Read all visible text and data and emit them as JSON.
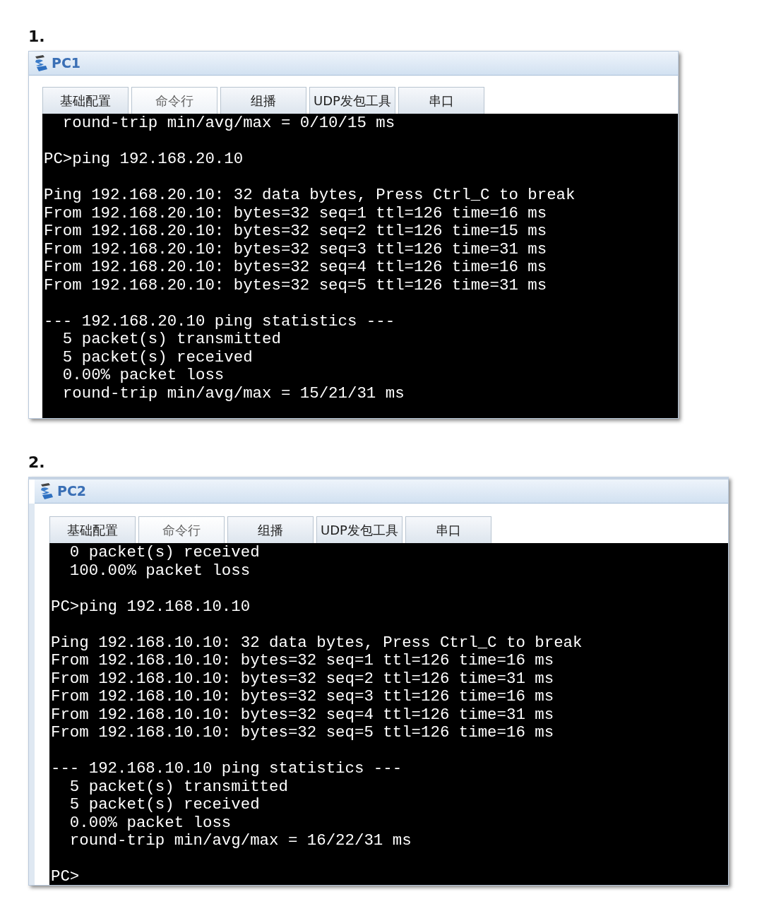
{
  "panels": [
    {
      "number": "1.",
      "window": {
        "title": "PC1"
      },
      "tabs": [
        {
          "label": "基础配置",
          "selected": false
        },
        {
          "label": "命令行",
          "selected": true
        },
        {
          "label": "组播",
          "selected": false
        },
        {
          "label": "UDP发包工具",
          "selected": false
        },
        {
          "label": "串口",
          "selected": false
        }
      ],
      "terminal": {
        "blocks": [
          [
            "  round-trip min/avg/max = 0/10/15 ms"
          ],
          [
            "PC>ping 192.168.20.10"
          ],
          [
            "Ping 192.168.20.10: 32 data bytes, Press Ctrl_C to break",
            "From 192.168.20.10: bytes=32 seq=1 ttl=126 time=16 ms",
            "From 192.168.20.10: bytes=32 seq=2 ttl=126 time=15 ms",
            "From 192.168.20.10: bytes=32 seq=3 ttl=126 time=31 ms",
            "From 192.168.20.10: bytes=32 seq=4 ttl=126 time=16 ms",
            "From 192.168.20.10: bytes=32 seq=5 ttl=126 time=31 ms"
          ],
          [
            "--- 192.168.20.10 ping statistics ---",
            "  5 packet(s) transmitted",
            "  5 packet(s) received",
            "  0.00% packet loss",
            "  round-trip min/avg/max = 15/21/31 ms"
          ]
        ]
      }
    },
    {
      "number": "2.",
      "window": {
        "title": "PC2"
      },
      "tabs": [
        {
          "label": "基础配置",
          "selected": false
        },
        {
          "label": "命令行",
          "selected": true
        },
        {
          "label": "组播",
          "selected": false
        },
        {
          "label": "UDP发包工具",
          "selected": false
        },
        {
          "label": "串口",
          "selected": false
        }
      ],
      "terminal": {
        "blocks": [
          [
            "  0 packet(s) received",
            "  100.00% packet loss"
          ],
          [
            "PC>ping 192.168.10.10"
          ],
          [
            "Ping 192.168.10.10: 32 data bytes, Press Ctrl_C to break",
            "From 192.168.10.10: bytes=32 seq=1 ttl=126 time=16 ms",
            "From 192.168.10.10: bytes=32 seq=2 ttl=126 time=31 ms",
            "From 192.168.10.10: bytes=32 seq=3 ttl=126 time=16 ms",
            "From 192.168.10.10: bytes=32 seq=4 ttl=126 time=31 ms",
            "From 192.168.10.10: bytes=32 seq=5 ttl=126 time=16 ms"
          ],
          [
            "--- 192.168.10.10 ping statistics ---",
            "  5 packet(s) transmitted",
            "  5 packet(s) received",
            "  0.00% packet loss",
            "  round-trip min/avg/max = 16/22/31 ms"
          ],
          [
            "PC>"
          ]
        ]
      }
    }
  ]
}
